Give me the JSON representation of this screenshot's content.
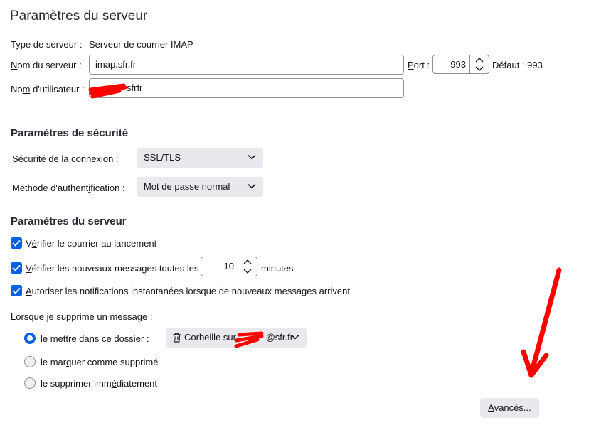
{
  "page": {
    "title": "Paramètres du serveur"
  },
  "server": {
    "type_label": "Type de serveur :",
    "type_value": "Serveur de courrier IMAP",
    "name_label_pre": "",
    "name_label_u": "N",
    "name_label_post": "om du serveur :",
    "name_value": "imap.sfr.fr",
    "port_label_u": "P",
    "port_label_post": "ort :",
    "port_value": "993",
    "port_default": "Défaut : 993",
    "user_label_pre": "No",
    "user_label_u": "m",
    "user_label_post": " d'utilisateur :",
    "user_value": "sfrfr"
  },
  "security": {
    "title": "Paramètres de sécurité",
    "connection_label_u": "S",
    "connection_label_post": "écurité de la connexion :",
    "connection_value": "SSL/TLS",
    "auth_label_pre": "Méthode d'authent",
    "auth_label_u": "i",
    "auth_label_post": "fication :",
    "auth_value": "Mot de passe normal"
  },
  "server_settings": {
    "title": "Paramètres du serveur",
    "check_startup_pre": "V",
    "check_startup_u": "é",
    "check_startup_post": "rifier le courrier au lancement",
    "check_new_u": "V",
    "check_new_post": "érifier les nouveaux messages toutes les",
    "interval_value": "10",
    "interval_unit": "minutes",
    "notify_u": "A",
    "notify_post": "utoriser les notifications instantanées lorsque de nouveaux messages arrivent"
  },
  "delete": {
    "label": "Lorsque je supprime un message :",
    "move_pre": "le mettre dans ce d",
    "move_u": "o",
    "move_post": "ssier :",
    "folder_value": "Corbeille sur ",
    "folder_suffix": "@sfr.fr",
    "mark_pre": "le mar",
    "mark_u": "q",
    "mark_post": "uer comme supprimé",
    "delete_pre": "le supprimer imm",
    "delete_u": "é",
    "delete_post": "diatement"
  },
  "buttons": {
    "advanced_u": "A",
    "advanced_post": "vancés..."
  },
  "colors": {
    "accent": "#0061e0",
    "annotation": "#ff0000"
  },
  "icons": {
    "checkbox": "checkmark-icon",
    "spin_up": "chevron-up-icon",
    "spin_down": "chevron-down-icon",
    "dropdown": "chevron-down-icon",
    "trash": "trash-icon",
    "annotation": "red-arrow-icon"
  }
}
